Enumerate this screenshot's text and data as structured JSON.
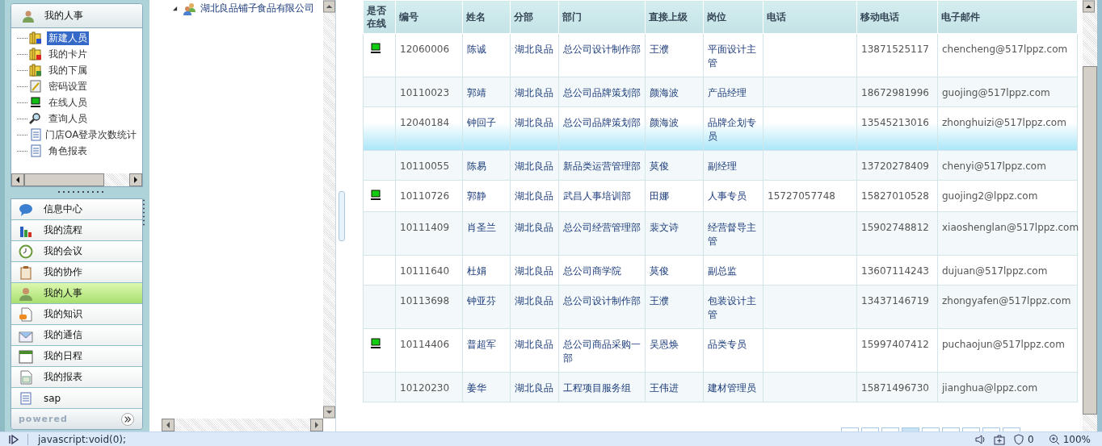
{
  "accordion": {
    "title": "我的人事",
    "tree_items": [
      {
        "label": "新建人员",
        "selected": true
      },
      {
        "label": "我的卡片",
        "selected": false
      },
      {
        "label": "我的下属",
        "selected": false
      },
      {
        "label": "密码设置",
        "selected": false
      },
      {
        "label": "在线人员",
        "selected": false
      },
      {
        "label": "查询人员",
        "selected": false
      },
      {
        "label": "门店OA登录次数统计",
        "selected": false
      },
      {
        "label": "角色报表",
        "selected": false
      }
    ]
  },
  "menu": [
    {
      "label": "信息中心",
      "selected": false
    },
    {
      "label": "我的流程",
      "selected": false
    },
    {
      "label": "我的会议",
      "selected": false
    },
    {
      "label": "我的协作",
      "selected": false
    },
    {
      "label": "我的人事",
      "selected": true
    },
    {
      "label": "我的知识",
      "selected": false
    },
    {
      "label": "我的通信",
      "selected": false
    },
    {
      "label": "我的日程",
      "selected": false
    },
    {
      "label": "我的报表",
      "selected": false
    },
    {
      "label": "sap",
      "selected": false
    }
  ],
  "powered": "powered",
  "org_tree": {
    "label": "湖北良品铺子食品有限公司",
    "expanded": true
  },
  "table": {
    "columns": [
      "是否在线",
      "编号",
      "姓名",
      "分部",
      "部门",
      "直接上级",
      "岗位",
      "电话",
      "移动电话",
      "电子邮件"
    ],
    "rows": [
      {
        "online": true,
        "selected": false,
        "id": "12060006",
        "name": "陈诚",
        "branch": "湖北良品",
        "dept": "总公司设计制作部",
        "manager": "王濮",
        "post": "平面设计主管",
        "phone": "",
        "mobile": "13871525117",
        "email": "chencheng@517lppz.com"
      },
      {
        "online": false,
        "selected": false,
        "id": "10110023",
        "name": "郭靖",
        "branch": "湖北良品",
        "dept": "总公司品牌策划部",
        "manager": "颜海波",
        "post": "产品经理",
        "phone": "",
        "mobile": "18672981996",
        "email": "guojing@517lppz.com"
      },
      {
        "online": false,
        "selected": true,
        "id": "12040184",
        "name": "钟回子",
        "branch": "湖北良品",
        "dept": "总公司品牌策划部",
        "manager": "颜海波",
        "post": "品牌企划专员",
        "phone": "",
        "mobile": "13545213016",
        "email": "zhonghuizi@517lppz.com"
      },
      {
        "online": false,
        "selected": false,
        "id": "10110055",
        "name": "陈易",
        "branch": "湖北良品",
        "dept": "新品类运营管理部",
        "manager": "莫俊",
        "post": "副经理",
        "phone": "",
        "mobile": "13720278409",
        "email": "chenyi@517lppz.com"
      },
      {
        "online": true,
        "selected": false,
        "id": "10110726",
        "name": "郭静",
        "branch": "湖北良品",
        "dept": "武昌人事培训部",
        "manager": "田娜",
        "post": "人事专员",
        "phone": "15727057748",
        "mobile": "15827010528",
        "email": "guojing2@lppz.com"
      },
      {
        "online": false,
        "selected": false,
        "id": "10111409",
        "name": "肖圣兰",
        "branch": "湖北良品",
        "dept": "总公司经营管理部",
        "manager": "裴文诗",
        "post": "经营督导主管",
        "phone": "",
        "mobile": "15902748812",
        "email": "xiaoshenglan@517lppz.com"
      },
      {
        "online": false,
        "selected": false,
        "id": "10111640",
        "name": "杜娟",
        "branch": "湖北良品",
        "dept": "总公司商学院",
        "manager": "莫俊",
        "post": "副总监",
        "phone": "",
        "mobile": "13607114243",
        "email": "dujuan@517lppz.com"
      },
      {
        "online": false,
        "selected": false,
        "id": "10113698",
        "name": "钟亚芬",
        "branch": "湖北良品",
        "dept": "总公司设计制作部",
        "manager": "王濮",
        "post": "包装设计主管",
        "phone": "",
        "mobile": "13437146719",
        "email": "zhongyafen@517lppz.com"
      },
      {
        "online": true,
        "selected": false,
        "id": "10114406",
        "name": "普超军",
        "branch": "湖北良品",
        "dept": "总公司商品采购一部",
        "manager": "吴恩焕",
        "post": "品类专员",
        "phone": "",
        "mobile": "15997407412",
        "email": "puchaojun@517lppz.com"
      },
      {
        "online": false,
        "selected": false,
        "id": "10120230",
        "name": "姜华",
        "branch": "湖北良品",
        "dept": "工程项目服务组",
        "manager": "王伟进",
        "post": "建材管理员",
        "phone": "",
        "mobile": "15871496730",
        "email": "jianghua@lppz.com"
      }
    ]
  },
  "status_bar": {
    "url": "javascript:void(0);",
    "blocked_count": "0",
    "zoom": "100%"
  }
}
